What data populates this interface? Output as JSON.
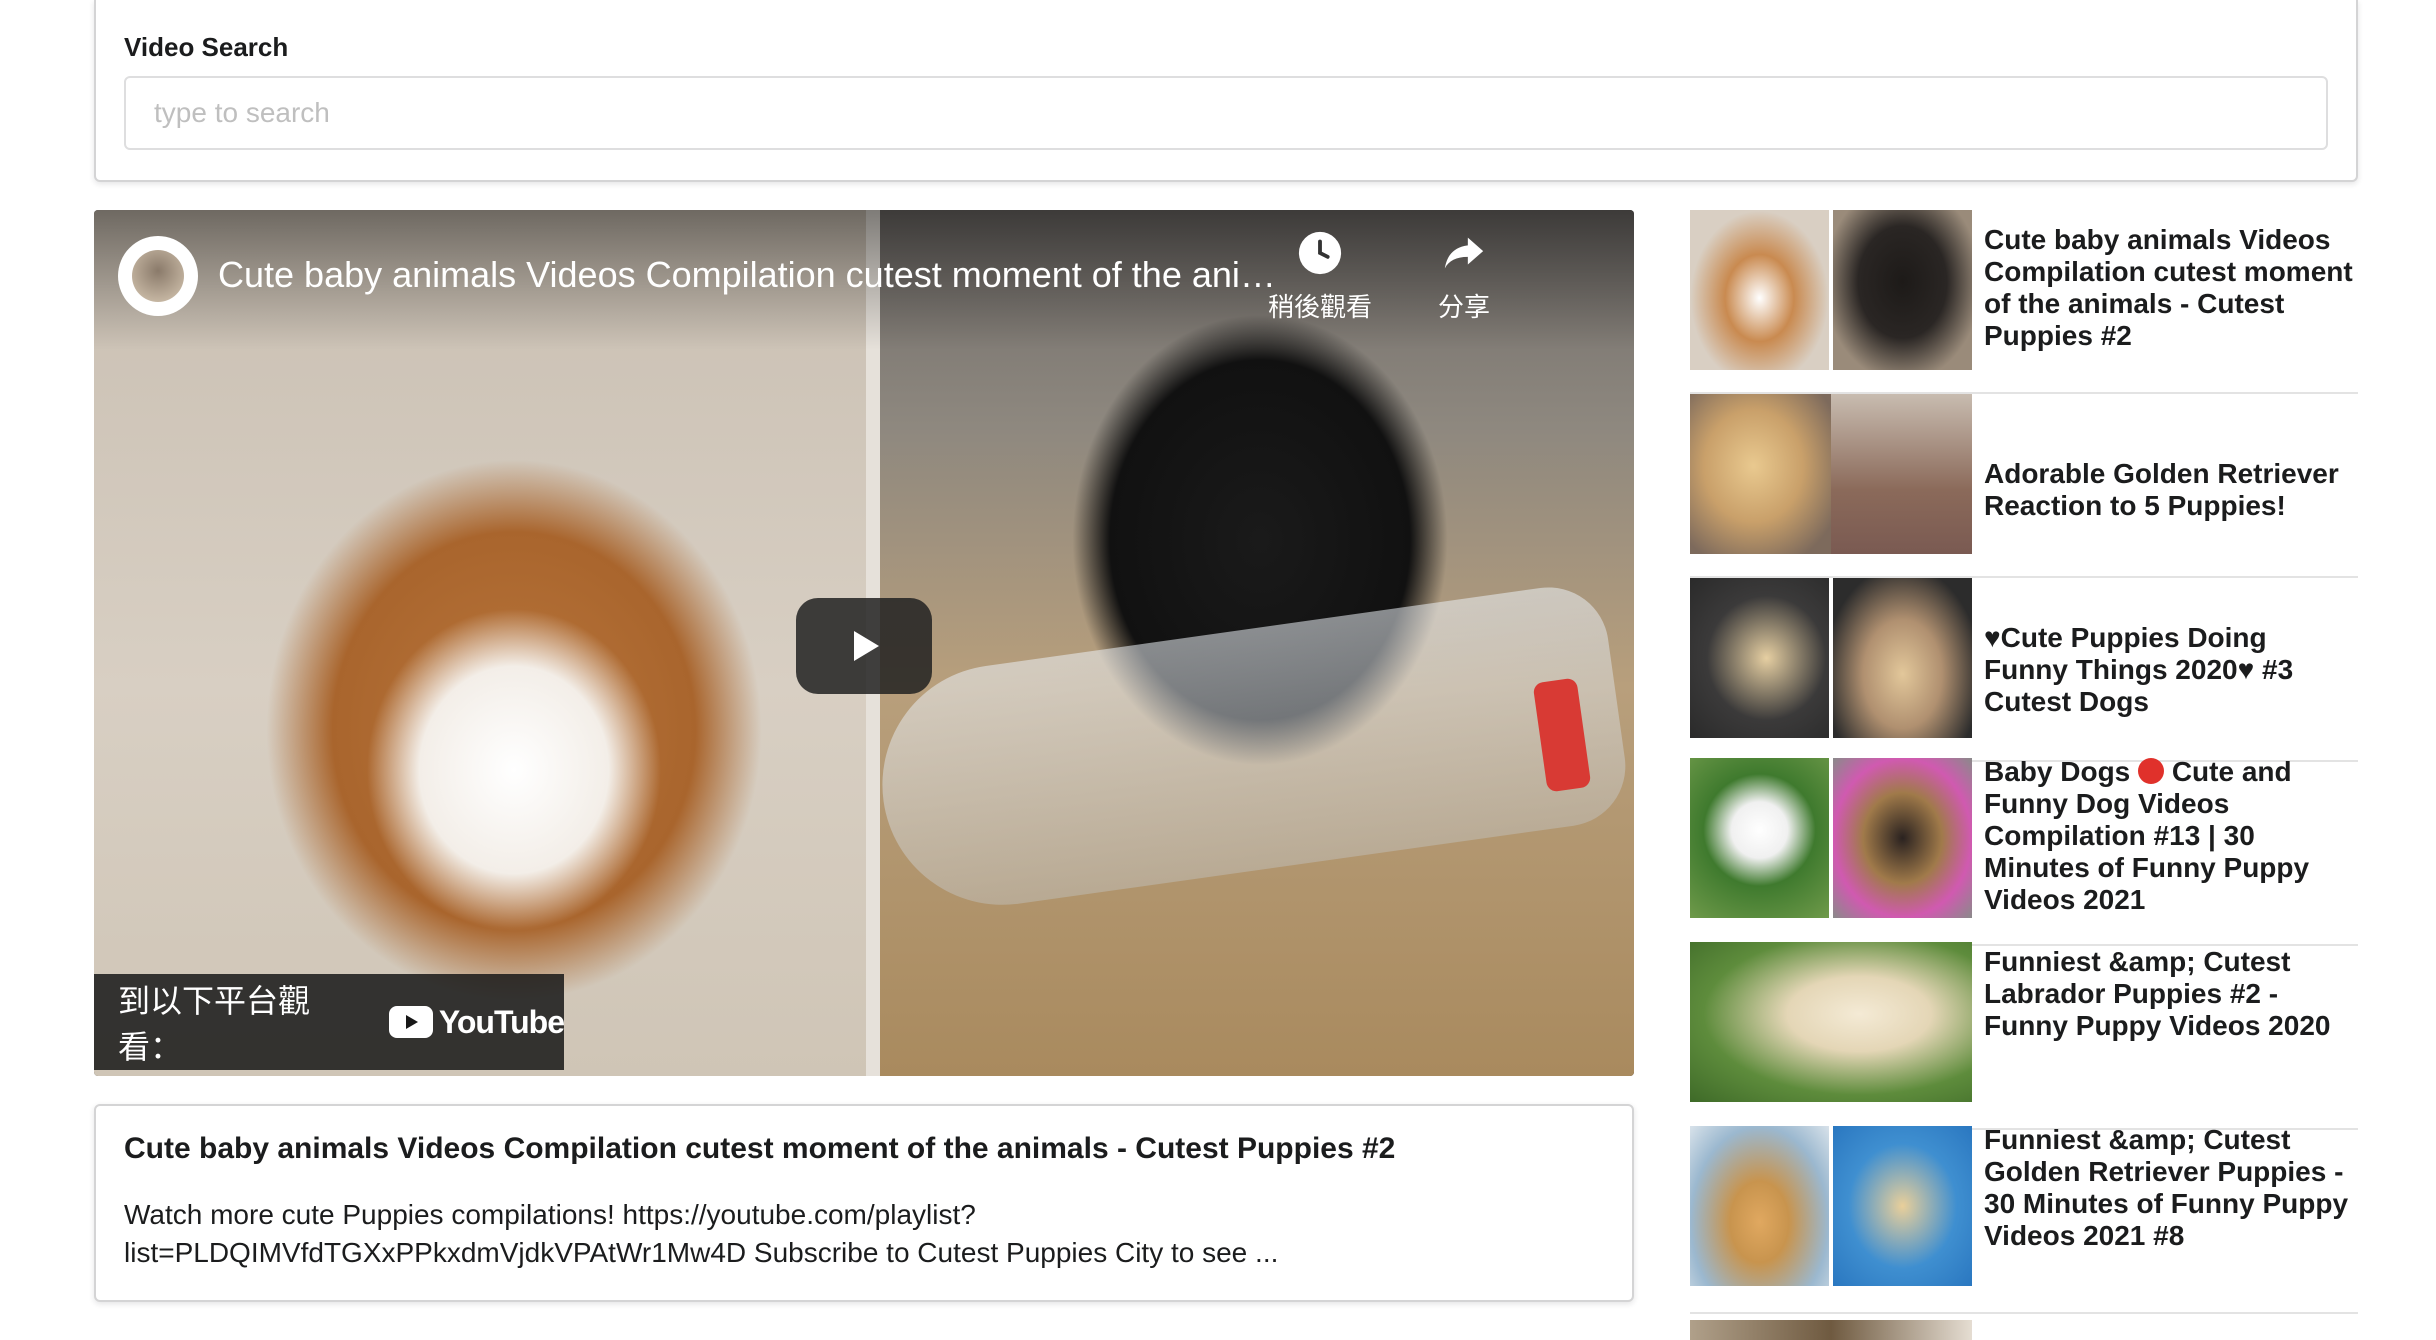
{
  "search": {
    "label": "Video Search",
    "placeholder": "type to search",
    "value": ""
  },
  "player": {
    "overlay_title": "Cute baby animals Videos Compilation cutest moment of the animals - Cutest Puppies #2",
    "actions": [
      {
        "icon": "clock-icon",
        "label": "稍後觀看"
      },
      {
        "icon": "share-icon",
        "label": "分享"
      }
    ],
    "watch_on_label": "到以下平台觀看：",
    "platform": "YouTube"
  },
  "selected_video": {
    "title": "Cute baby animals Videos Compilation cutest moment of the animals - Cutest Puppies #2",
    "description": "Watch more cute Puppies compilations! https://youtube.com/playlist?list=PLDQIMVfdTGXxPPkxdmVjdkVPAtWr1Mw4D Subscribe to Cutest Puppies City to see ..."
  },
  "video_list": [
    {
      "title": "Cute baby animals Videos Compilation cutest moment of the animals - Cutest Puppies #2",
      "colors": [
        "#b87b45",
        "#2a2624"
      ]
    },
    {
      "title": "Adorable Golden Retriever Reaction to 5 Puppies!",
      "colors": [
        "#d6b27c",
        "#8b6a5a"
      ]
    },
    {
      "title": "♥Cute Puppies Doing Funny Things 2020♥ #3 Cutest Dogs",
      "colors": [
        "#4a4848",
        "#c9a97d"
      ]
    },
    {
      "title_before": "Baby Dogs",
      "title_after": "Cute and Funny Dog Videos Compilation #13 | 30 Minutes of Funny Puppy Videos 2021",
      "colors": [
        "#6f9a4a",
        "#3b3430"
      ]
    },
    {
      "title": "Funniest &amp; Cutest Labrador Puppies #2 - Funny Puppy Videos 2020",
      "colors": [
        "#5e8c3c",
        "#d9c9a6"
      ]
    },
    {
      "title": "Funniest &amp; Cutest Golden Retriever Puppies - 30 Minutes of Funny Puppy Videos 2021 #8",
      "colors": [
        "#8fb5d4",
        "#3f8fd0"
      ]
    }
  ]
}
